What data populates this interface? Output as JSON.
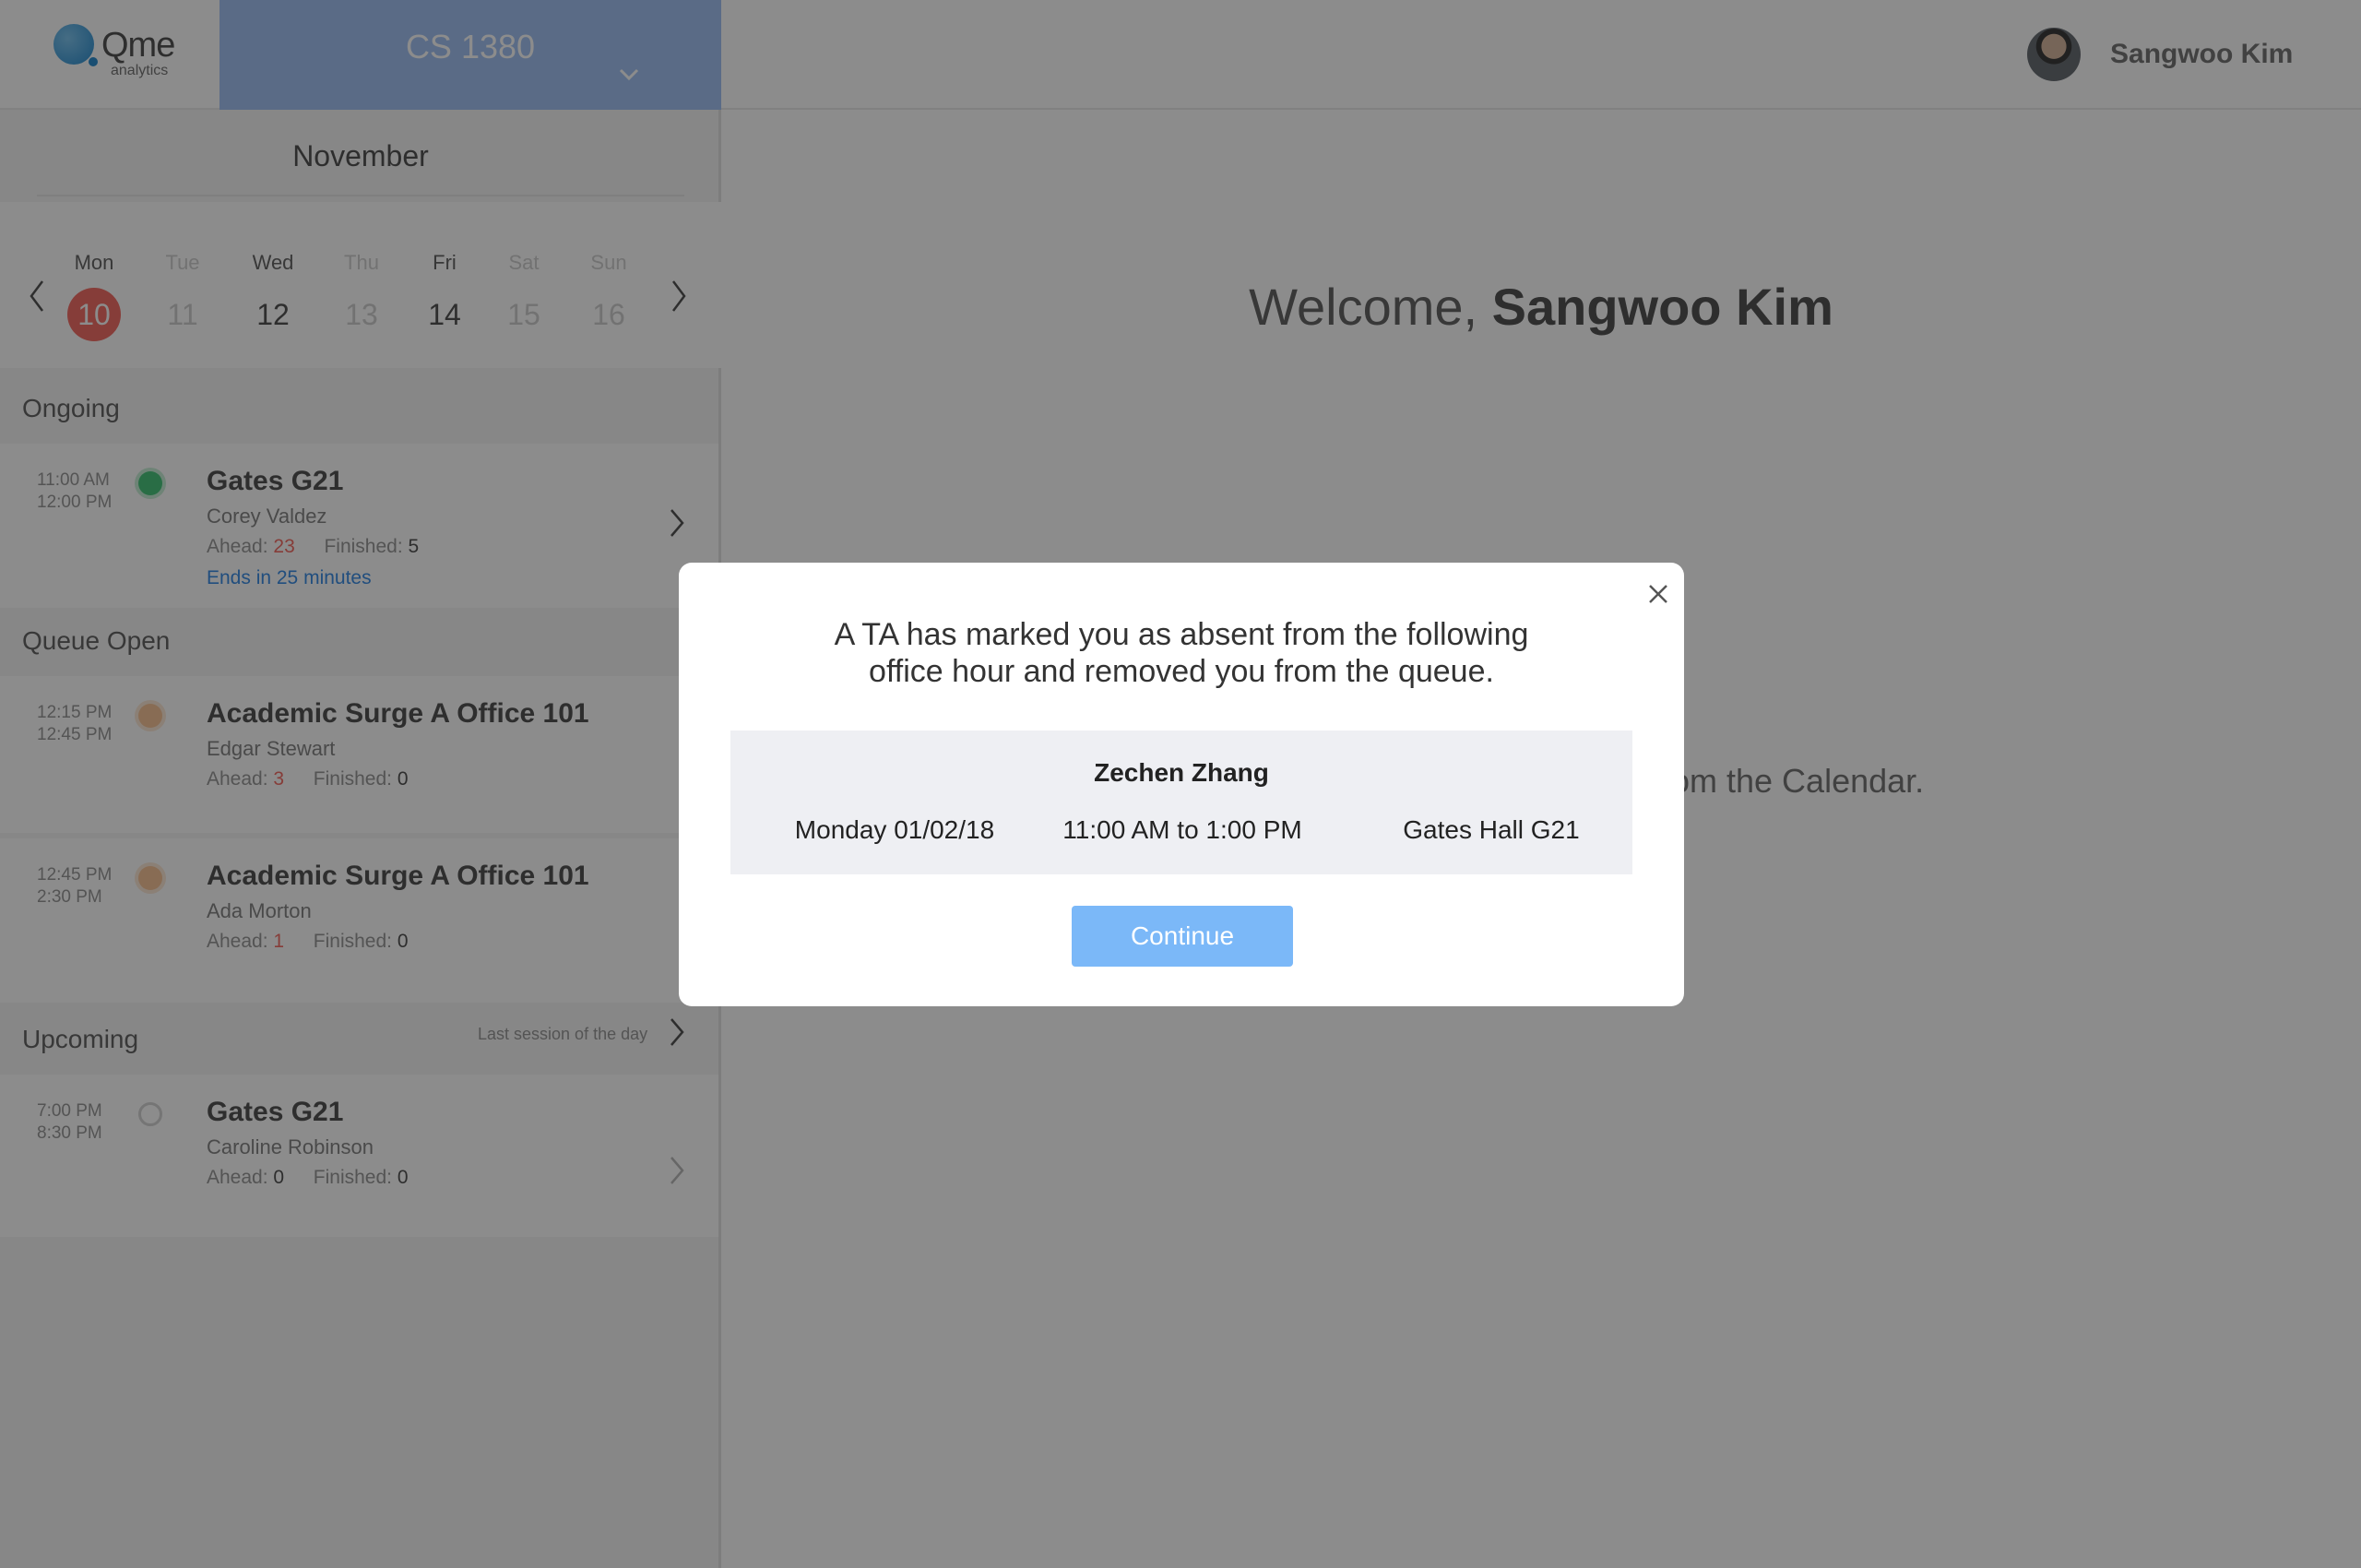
{
  "header": {
    "logo_text": "Qme",
    "logo_sub": "analytics",
    "course": "CS 1380",
    "user_name": "Sangwoo Kim"
  },
  "calendar": {
    "month": "November",
    "days": [
      {
        "name": "Mon",
        "num": "10"
      },
      {
        "name": "Tue",
        "num": "11"
      },
      {
        "name": "Wed",
        "num": "12"
      },
      {
        "name": "Thu",
        "num": "13"
      },
      {
        "name": "Fri",
        "num": "14"
      },
      {
        "name": "Sat",
        "num": "15"
      },
      {
        "name": "Sun",
        "num": "16"
      }
    ]
  },
  "sections": {
    "ongoing": "Ongoing",
    "queue_open": "Queue Open",
    "upcoming": "Upcoming",
    "upcoming_meta": "Last session of the day"
  },
  "labels": {
    "ahead": "Ahead:",
    "finished": "Finished:"
  },
  "sessions": {
    "ongoing": [
      {
        "start": "11:00 AM",
        "end": "12:00 PM",
        "title": "Gates G21",
        "host": "Corey Valdez",
        "ahead": "23",
        "finished": "5",
        "note": "Ends in 25 minutes",
        "status_color": "#4cc77f"
      }
    ],
    "queue_open": [
      {
        "start": "12:15 PM",
        "end": "12:45 PM",
        "title": "Academic Surge A Office 101",
        "host": "Edgar Stewart",
        "ahead": "3",
        "finished": "0",
        "status_color": "#f7c59a"
      },
      {
        "start": "12:45 PM",
        "end": "2:30 PM",
        "title": "Academic Surge A Office 101",
        "host": "Ada Morton",
        "ahead": "1",
        "finished": "0",
        "status_color": "#f7c59a"
      }
    ],
    "upcoming": [
      {
        "start": "7:00 PM",
        "end": "8:30 PM",
        "title": "Gates G21",
        "host": "Caroline Robinson",
        "ahead": "0",
        "finished": "0",
        "status_color": "#d6d6d6"
      }
    ]
  },
  "main": {
    "welcome_prefix": "Welcome, ",
    "welcome_name": "Sangwoo Kim",
    "hint_partial": "om the Calendar."
  },
  "modal": {
    "message_line1": "A TA has marked you as absent from the following",
    "message_line2": "office hour and removed you from the queue.",
    "ta_name": "Zechen Zhang",
    "date": "Monday 01/02/18",
    "time": "11:00 AM to 1:00 PM",
    "location": "Gates Hall G21",
    "continue_label": "Continue"
  },
  "colors": {
    "accent": "#7bb8f8",
    "course_bar": "#a5c4f4",
    "today": "#f47068",
    "highlight_number": "#f47068",
    "link": "#3d8ee5"
  },
  "icons": {
    "close": "close-icon",
    "chevron_down": "chevron-down-icon",
    "chevron_left": "chevron-left-icon",
    "chevron_right": "chevron-right-icon"
  }
}
